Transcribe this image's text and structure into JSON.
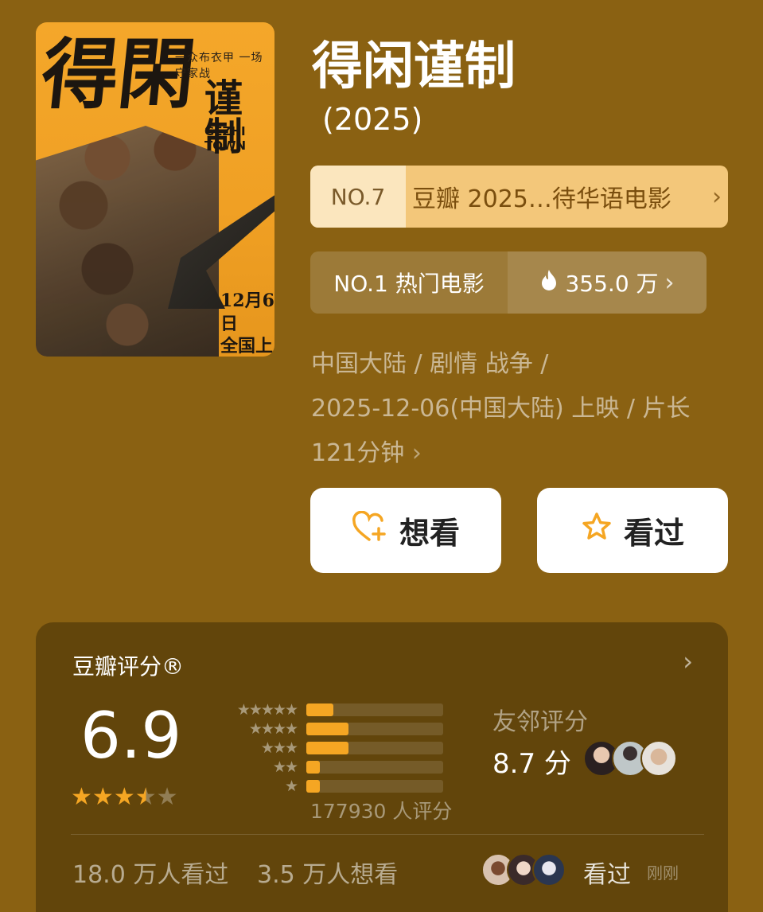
{
  "poster": {
    "slogan": "一众布衣甲 一场守家战",
    "title_cn": "得闲谨制",
    "title_en": "GEZHI TOWN",
    "release_line1": "12月6日",
    "release_line2": "全国上映"
  },
  "movie": {
    "title": "得闲谨制",
    "year": "(2025)"
  },
  "rank_primary": {
    "number": "NO.7",
    "label": "豆瓣 2025…待华语电影"
  },
  "rank_hot": {
    "label": "NO.1 热门电影",
    "heat": "355.0 万"
  },
  "meta": {
    "line1": "中国大陆 / 剧情 战争 /",
    "line2": "2025-12-06(中国大陆) 上映 / 片长",
    "line3": "121分钟"
  },
  "actions": {
    "want_label": "想看",
    "seen_label": "看过"
  },
  "rating": {
    "title": "豆瓣评分®",
    "score": "6.9",
    "stars_filled": 3.5,
    "distribution": [
      {
        "stars": "★★★★★",
        "fraction": 0.2
      },
      {
        "stars": "★★★★",
        "fraction": 0.31
      },
      {
        "stars": "★★★",
        "fraction": 0.31
      },
      {
        "stars": "★★",
        "fraction": 0.1
      },
      {
        "stars": "★",
        "fraction": 0.1
      }
    ],
    "count": "177930 人评分",
    "friends_label": "友邻评分",
    "friends_score": "8.7 分",
    "watched": "18.0 万人看过",
    "want": "3.5 万人想看",
    "recent_action": "看过",
    "recent_time": "刚刚"
  },
  "colors": {
    "background": "#8a6112",
    "card": "#62450b",
    "accent": "#f5a623"
  }
}
